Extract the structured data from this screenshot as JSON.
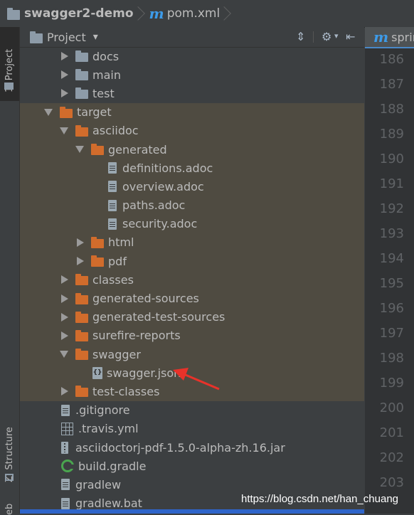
{
  "breadcrumb": {
    "project": "swagger2-demo",
    "file": "pom.xml",
    "file_icon": "m"
  },
  "left_strip": {
    "project_tab": "1: Project",
    "structure_tab": "Z: Structure",
    "web_tab": "eb"
  },
  "panel": {
    "title": "Project",
    "dropdown_glyph": "▾"
  },
  "tree": [
    {
      "label": "docs",
      "indent": 2,
      "arrow": "right",
      "icon": "folder-gray",
      "excluded": false
    },
    {
      "label": "main",
      "indent": 2,
      "arrow": "right",
      "icon": "folder-gray",
      "excluded": false
    },
    {
      "label": "test",
      "indent": 2,
      "arrow": "right",
      "icon": "folder-gray",
      "excluded": false
    },
    {
      "label": "target",
      "indent": 1,
      "arrow": "down",
      "icon": "folder-orange",
      "excluded": true
    },
    {
      "label": "asciidoc",
      "indent": 2,
      "arrow": "down",
      "icon": "folder-orange",
      "excluded": true
    },
    {
      "label": "generated",
      "indent": 3,
      "arrow": "down",
      "icon": "folder-orange",
      "excluded": true
    },
    {
      "label": "definitions.adoc",
      "indent": 4,
      "arrow": "none",
      "icon": "file",
      "excluded": true
    },
    {
      "label": "overview.adoc",
      "indent": 4,
      "arrow": "none",
      "icon": "file",
      "excluded": true
    },
    {
      "label": "paths.adoc",
      "indent": 4,
      "arrow": "none",
      "icon": "file",
      "excluded": true
    },
    {
      "label": "security.adoc",
      "indent": 4,
      "arrow": "none",
      "icon": "file",
      "excluded": true
    },
    {
      "label": "html",
      "indent": 3,
      "arrow": "right",
      "icon": "folder-orange",
      "excluded": true
    },
    {
      "label": "pdf",
      "indent": 3,
      "arrow": "right",
      "icon": "folder-orange",
      "excluded": true
    },
    {
      "label": "classes",
      "indent": 2,
      "arrow": "right",
      "icon": "folder-orange",
      "excluded": true
    },
    {
      "label": "generated-sources",
      "indent": 2,
      "arrow": "right",
      "icon": "folder-orange",
      "excluded": true
    },
    {
      "label": "generated-test-sources",
      "indent": 2,
      "arrow": "right",
      "icon": "folder-orange",
      "excluded": true
    },
    {
      "label": "surefire-reports",
      "indent": 2,
      "arrow": "right",
      "icon": "folder-orange",
      "excluded": true
    },
    {
      "label": "swagger",
      "indent": 2,
      "arrow": "down",
      "icon": "folder-orange",
      "excluded": true
    },
    {
      "label": "swagger.json",
      "indent": 3,
      "arrow": "none",
      "icon": "json-file",
      "excluded": true
    },
    {
      "label": "test-classes",
      "indent": 2,
      "arrow": "right",
      "icon": "folder-orange",
      "excluded": true
    },
    {
      "label": ".gitignore",
      "indent": 1,
      "arrow": "none",
      "icon": "file",
      "excluded": false
    },
    {
      "label": ".travis.yml",
      "indent": 1,
      "arrow": "none",
      "icon": "grid-file",
      "excluded": false
    },
    {
      "label": "asciidoctorj-pdf-1.5.0-alpha-zh.16.jar",
      "indent": 1,
      "arrow": "none",
      "icon": "jar-file",
      "excluded": false
    },
    {
      "label": "build.gradle",
      "indent": 1,
      "arrow": "none",
      "icon": "gradle-icon",
      "excluded": false
    },
    {
      "label": "gradlew",
      "indent": 1,
      "arrow": "none",
      "icon": "file",
      "excluded": false
    },
    {
      "label": "gradlew.bat",
      "indent": 1,
      "arrow": "none",
      "icon": "file",
      "excluded": false
    }
  ],
  "editor": {
    "tab_label": "sprin",
    "tab_icon": "m",
    "line_numbers": [
      "186",
      "187",
      "188",
      "189",
      "190",
      "191",
      "192",
      "193",
      "194",
      "195",
      "196",
      "197",
      "198",
      "199",
      "200",
      "201",
      "202",
      "203"
    ]
  },
  "watermark": "https://blog.csdn.net/han_chuang",
  "colors": {
    "background": "#3c3f41",
    "excluded_row": "#4f4b41",
    "folder_orange": "#d16c2c",
    "folder_gray": "#8d9ba8",
    "annotation_arrow": "#e8322a",
    "accent_blue": "#3d9be9"
  }
}
